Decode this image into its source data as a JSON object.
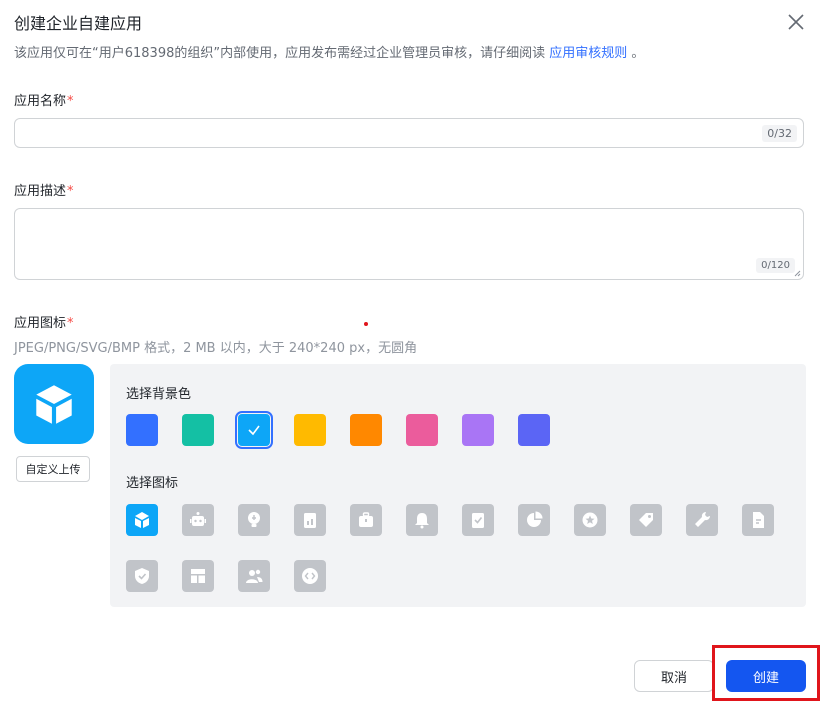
{
  "dialog": {
    "title": "创建企业自建应用",
    "description_prefix": "该应用仅可在“用户618398的组织”内部使用，应用发布需经过企业管理员审核，请仔细阅读 ",
    "description_link": "应用审核规则",
    "description_suffix": " 。"
  },
  "form": {
    "name": {
      "label": "应用名称",
      "required_mark": "*",
      "value": "",
      "counter": "0/32"
    },
    "description": {
      "label": "应用描述",
      "required_mark": "*",
      "value": "",
      "counter": "0/120"
    },
    "icon": {
      "label": "应用图标",
      "required_mark": "*",
      "hint": "JPEG/PNG/SVG/BMP 格式，2 MB 以内，大于 240*240 px，无圆角",
      "upload_label": "自定义上传",
      "background_label": "选择背景色",
      "icon_label": "选择图标",
      "selected_color_index": 2,
      "colors": [
        "#3370ff",
        "#14c0a4",
        "#0da6f7",
        "#ffba00",
        "#ff8800",
        "#eb5c9c",
        "#a975f5",
        "#5b65f5"
      ],
      "icons": [
        "cube-icon",
        "robot-icon",
        "lightbulb-icon",
        "document-chart-icon",
        "briefcase-icon",
        "bell-icon",
        "check-book-icon",
        "pie-chart-icon",
        "star-badge-icon",
        "tag-icon",
        "wrench-icon",
        "file-icon",
        "shield-icon",
        "layout-icon",
        "users-icon",
        "code-icon"
      ],
      "selected_icon_index": 0
    }
  },
  "footer": {
    "cancel_label": "取消",
    "create_label": "创建"
  }
}
